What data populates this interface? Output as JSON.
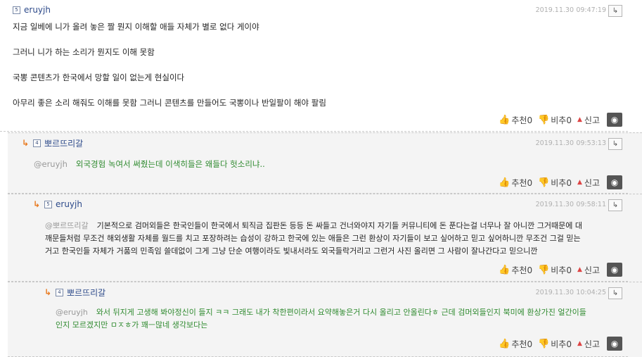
{
  "comments": [
    {
      "nickname": "eruyjh",
      "level": "5",
      "date": "2019.11.30",
      "time": "09:47:19",
      "paragraphs": [
        "지금 일베에 니가 올려 놓은 짤 뭔지 이해할 애들 자체가 별로 없다 게이야",
        "그러니 니가 하는 소리가 뭔지도 이해 못함",
        "국뽕 콘텐츠가 한국에서 망할 일이 없는게 현실이다",
        "아무리 좋은 소리 해줘도 이해를 못함 그러니 콘텐츠를 만들어도 국뽕이나 반일팔이 해야 팔림"
      ],
      "upvote": "추천0",
      "downvote": "비추0",
      "report": "신고"
    },
    {
      "nickname": "뽀르뜨리갈",
      "level": "4",
      "date": "2019.11.30",
      "time": "09:53:13",
      "mention": "@eruyjh",
      "text": "외국경험 녹여서 써줬는데 이색히들은 왜들다 헛소리냐..",
      "upvote": "추천0",
      "downvote": "비추0",
      "report": "신고"
    },
    {
      "nickname": "eruyjh",
      "level": "5",
      "date": "2019.11.30",
      "time": "09:58:11",
      "mention": "@뽀르뜨리갈",
      "text_line1": "기본적으로 검머외들은 한국인들이 한국에서 퇴직금 집판돈 등등 돈 싸들고 건너와야지 자기들 커뮤니티에 돈 푼다는걸 너무나 잘 아니깐 그거때문에 대",
      "text_line2": "깨문들처럼 무조건 해외생활 자체를 월드를 치고 포장하려는 습성이 강하고 한국에 있는 애들은 그런 환상이 자기들이 보고 싶어하고 믿고 싶어하니깐 무조건 그걸 믿는",
      "text_line3": "거고 한국인들 자체가 거품의 민족임 쓸데없이 그게 그냥 단순 여행이라도 빛내서라도 외국들락거리고 그런거 사진 올리면 그 사람이 잘나간다고 믿으니깐",
      "upvote": "추천0",
      "downvote": "비추0",
      "report": "신고"
    },
    {
      "nickname": "뽀르뜨리갈",
      "level": "4",
      "date": "2019.11.30",
      "time": "10:04:25",
      "mention": "@eruyjh",
      "text_line1": "와서 뒤지게 고생해 봐야정신이 들지 ㅋㅋ 그래도 내가 착한편이라서 요약해놓은거 다시 올리고 안올린다ㅎ 근데 검머외들인지 북미에 환상가진 얼간이들",
      "text_line2": "인지 모르겠지만 ㅁㅈㅎ가 꽤ㅡ많네 생각보다는",
      "upvote": "추천0",
      "downvote": "비추0",
      "report": "신고"
    }
  ]
}
